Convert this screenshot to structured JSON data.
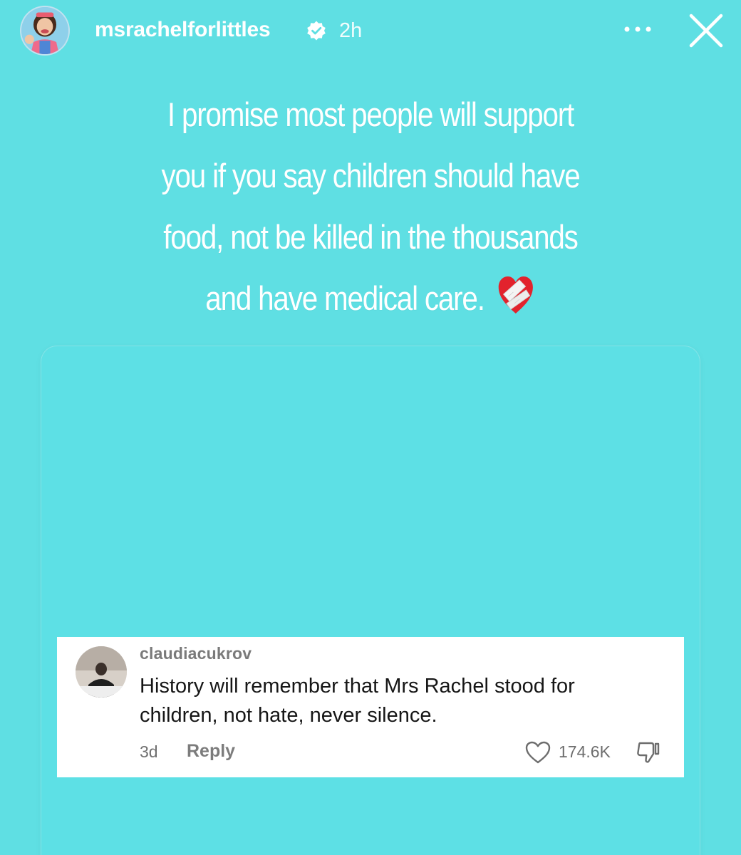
{
  "header": {
    "username": "msrachelforlittles",
    "timestamp": "2h",
    "more_icon": "more-horizontal-icon",
    "close_icon": "close-icon",
    "verified_icon": "verified-badge-icon"
  },
  "story": {
    "line1": "I promise most people will support",
    "line2": "you if you say children should have",
    "line3": "food, not be killed in the thousands",
    "line4": "and have medical care.",
    "emoji_icon": "mending-heart-emoji"
  },
  "comment": {
    "username": "claudiacukrov",
    "text_line1": "History will remember that Mrs Rachel stood for",
    "text_line2": "children, not hate, never silence.",
    "age": "3d",
    "reply_label": "Reply",
    "like_count": "174.6K",
    "like_icon": "heart-outline-icon",
    "dislike_icon": "thumbs-down-icon"
  },
  "colors": {
    "background": "#5fdfe3",
    "card": "#ffffff",
    "text_primary": "#ffffff"
  }
}
